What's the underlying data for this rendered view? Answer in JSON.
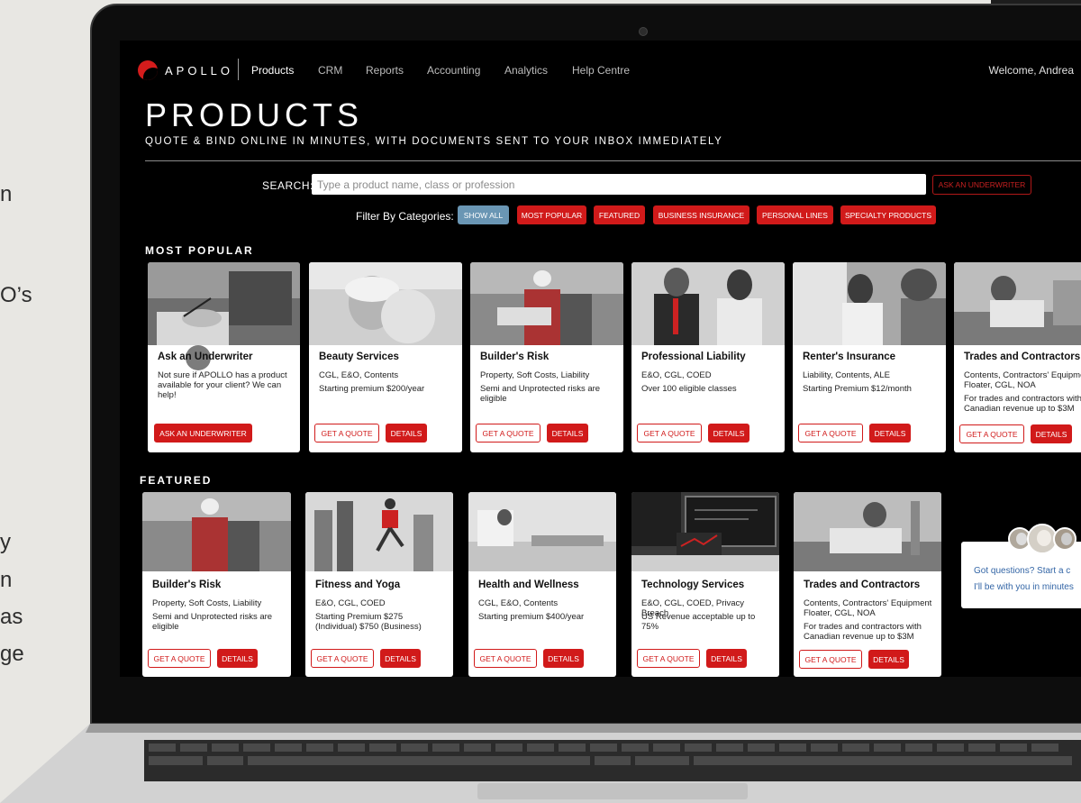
{
  "background": {
    "fragments": [
      "n",
      "O’s",
      "y",
      "n",
      "as",
      "ge"
    ]
  },
  "nav": {
    "logo": "APOLLO",
    "links": [
      "Products",
      "CRM",
      "Reports",
      "Accounting",
      "Analytics",
      "Help Centre"
    ],
    "welcome": "Welcome, Andrea"
  },
  "page": {
    "title": "PRODUCTS",
    "subtitle": "QUOTE & BIND ONLINE IN MINUTES, WITH DOCUMENTS SENT TO YOUR INBOX IMMEDIATELY"
  },
  "search": {
    "label": "SEARCH:",
    "placeholder": "Type a product name, class or profession",
    "ask_button": "ASK AN UNDERWRITER"
  },
  "filters": {
    "label": "Filter By Categories:",
    "chips": [
      "SHOW ALL",
      "MOST POPULAR",
      "FEATURED",
      "BUSINESS INSURANCE",
      "PERSONAL LINES",
      "SPECIALTY PRODUCTS"
    ]
  },
  "most_popular": {
    "title": "MOST POPULAR",
    "cards": [
      {
        "title": "Ask an Underwriter",
        "lines": [
          "Not sure if APOLLO has a product available for your client? We can help!"
        ],
        "button": "ASK AN UNDERWRITER"
      },
      {
        "title": "Beauty Services",
        "lines": [
          "CGL, E&O, Contents",
          "Starting premium $200/year"
        ],
        "quote": "GET A QUOTE",
        "details": "DETAILS"
      },
      {
        "title": "Builder's Risk",
        "lines": [
          "Property, Soft Costs, Liability",
          "Semi and Unprotected risks are eligible"
        ],
        "quote": "GET A QUOTE",
        "details": "DETAILS"
      },
      {
        "title": "Professional Liability",
        "lines": [
          "E&O, CGL, COED",
          "Over 100 eligible classes"
        ],
        "quote": "GET A QUOTE",
        "details": "DETAILS"
      },
      {
        "title": "Renter's Insurance",
        "lines": [
          "Liability, Contents, ALE",
          "Starting Premium $12/month"
        ],
        "quote": "GET A QUOTE",
        "details": "DETAILS"
      },
      {
        "title": "Trades and Contractors",
        "lines": [
          "Contents, Contractors' Equipment Floater, CGL, NOA",
          "For trades and contractors with Canadian revenue up to $3M"
        ],
        "quote": "GET A QUOTE",
        "details": "DETAILS"
      }
    ]
  },
  "featured": {
    "title": "FEATURED",
    "cards": [
      {
        "title": "Builder's Risk",
        "lines": [
          "Property, Soft Costs, Liability",
          "Semi and Unprotected risks are eligible"
        ],
        "quote": "GET A QUOTE",
        "details": "DETAILS"
      },
      {
        "title": "Fitness and Yoga",
        "lines": [
          "E&O, CGL, COED",
          "Starting Premium $275 (Individual) $750 (Business)"
        ],
        "quote": "GET A QUOTE",
        "details": "DETAILS"
      },
      {
        "title": "Health and Wellness",
        "lines": [
          "CGL, E&O, Contents",
          "Starting premium $400/year"
        ],
        "quote": "GET A QUOTE",
        "details": "DETAILS"
      },
      {
        "title": "Technology Services",
        "lines": [
          "E&O, CGL, COED, Privacy Breach",
          "US Revenue acceptable up to 75%"
        ],
        "quote": "GET A QUOTE",
        "details": "DETAILS"
      },
      {
        "title": "Trades and Contractors",
        "lines": [
          "Contents, Contractors' Equipment Floater, CGL, NOA",
          "For trades and contractors with Canadian revenue up to $3M"
        ],
        "quote": "GET A QUOTE",
        "details": "DETAILS"
      }
    ]
  },
  "chat": {
    "line1": "Got questions? Start a c",
    "line2": "I'll be with you in minutes"
  },
  "colors": {
    "accent": "#d11a1a",
    "show_all": "#6a96b4",
    "screen_bg": "#000000",
    "chat_text": "#3466a6"
  }
}
